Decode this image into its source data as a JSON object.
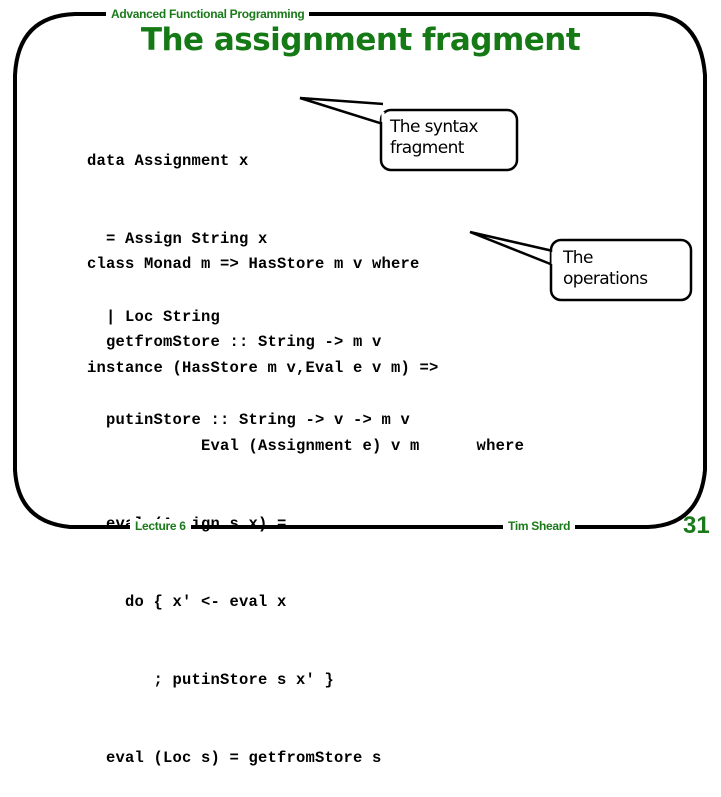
{
  "slide": {
    "course_title": "Advanced Functional Programming",
    "title": "The assignment fragment",
    "lecture": "Lecture 6",
    "author": "Tim Sheard",
    "page_number": "31",
    "accent_color": "#1a7a1a"
  },
  "code": {
    "data_decl": [
      "data Assignment x",
      "  = Assign String x",
      "  | Loc String"
    ],
    "class_decl": [
      "class Monad m => HasStore m v where",
      "  getfromStore :: String -> m v",
      "  putinStore :: String -> v -> m v"
    ],
    "instance_decl": [
      "instance (HasStore m v,Eval e v m) =>",
      "            Eval (Assignment e) v m      where",
      "  eval (Assign s x) =",
      "    do { x' <- eval x",
      "       ; putinStore s x' }",
      "  eval (Loc s) = getfromStore s"
    ]
  },
  "callouts": {
    "syntax": [
      "The syntax",
      "fragment"
    ],
    "operations": [
      "The",
      "operations"
    ]
  }
}
